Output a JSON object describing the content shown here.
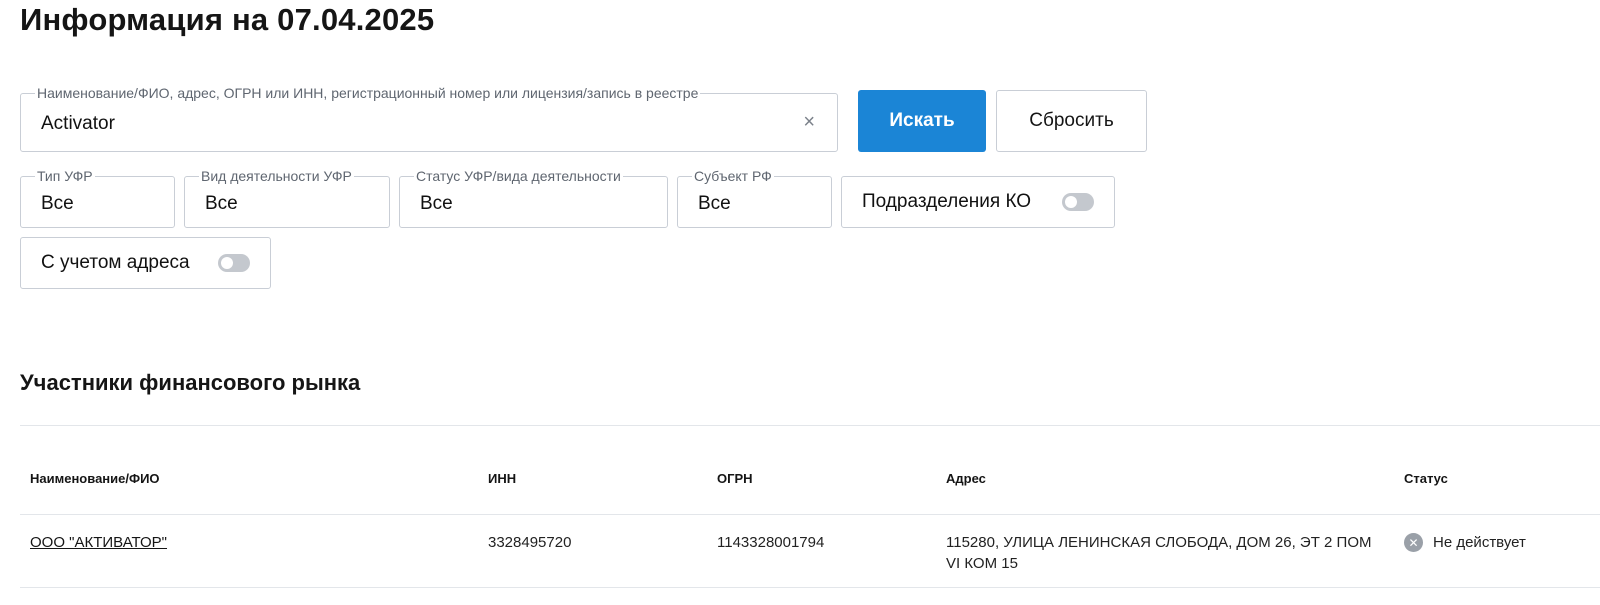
{
  "header": {
    "title": "Информация на 07.04.2025"
  },
  "search": {
    "legend": "Наименование/ФИО, адрес, ОГРН или ИНН, регистрационный номер или лицензия/запись в реестре",
    "value": "Activator",
    "clear_icon": "×",
    "submit_label": "Искать",
    "reset_label": "Сбросить"
  },
  "filters": {
    "type": {
      "legend": "Тип УФР",
      "value": "Все"
    },
    "activity": {
      "legend": "Вид деятельности УФР",
      "value": "Все"
    },
    "status": {
      "legend": "Статус УФР/вида деятельности",
      "value": "Все"
    },
    "region": {
      "legend": "Субъект РФ",
      "value": "Все"
    },
    "ko_divisions": {
      "label": "Подразделения КО",
      "enabled": false
    },
    "with_address": {
      "label": "С учетом адреса",
      "enabled": false
    }
  },
  "results": {
    "title": "Участники финансового рынка",
    "columns": [
      "Наименование/ФИО",
      "ИНН",
      "ОГРН",
      "Адрес",
      "Статус"
    ],
    "rows": [
      {
        "name": "ООО \"АКТИВАТОР\"",
        "inn": "3328495720",
        "ogrn": "1143328001794",
        "address": "115280, УЛИЦА ЛЕНИНСКАЯ СЛОБОДА, ДОМ 26, ЭТ 2 ПОМ VI КОМ 15",
        "status": "Не действует",
        "status_icon": "✕"
      }
    ]
  },
  "colors": {
    "primary": "#1b85d6",
    "border": "#c9ced6",
    "status_inactive": "#9aa0a8"
  }
}
